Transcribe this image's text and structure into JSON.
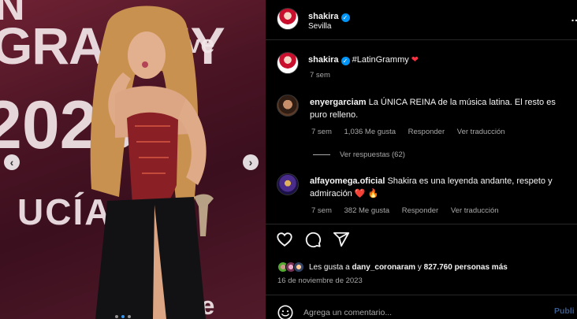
{
  "photo": {
    "wall_text": [
      "N",
      "GRAMMY",
      "2023",
      "UCÍA",
      "tve",
      "tve"
    ],
    "carousel_dots": 3,
    "active_dot": 1
  },
  "header": {
    "username": "shakira",
    "location": "Sevilla",
    "more_icon": "ellipsis-icon"
  },
  "caption": {
    "username": "shakira",
    "text": "#LatinGrammy",
    "emoji": "❤",
    "time": "7 sem"
  },
  "comments": [
    {
      "username": "enyergarciam",
      "text": "La ÚNICA REINA de la música latina. El resto es puro relleno.",
      "time": "7 sem",
      "likes": "1,036 Me gusta",
      "reply_label": "Responder",
      "translate_label": "Ver traducción",
      "view_replies": "Ver respuestas (62)"
    },
    {
      "username": "alfayomega.oficial",
      "text": "Shakira es una leyenda andante, respeto y admiración",
      "emoji": "❤️ 🔥",
      "time": "7 sem",
      "likes": "382 Me gusta",
      "reply_label": "Responder",
      "translate_label": "Ver traducción"
    }
  ],
  "actions": [
    "heart-icon",
    "comment-icon",
    "share-icon"
  ],
  "likes": {
    "prefix": "Les gusta a ",
    "user": "dany_coronaram",
    "middle": " y ",
    "count": "827.760 personas más"
  },
  "date": "16 de noviembre de 2023",
  "add_comment": {
    "placeholder": "Agrega un comentario...",
    "publish_label": "Publi"
  },
  "colors": {
    "background": "#000000",
    "muted": "#a8a8a8",
    "verified": "#0095f6",
    "like_red": "#ff3040"
  }
}
